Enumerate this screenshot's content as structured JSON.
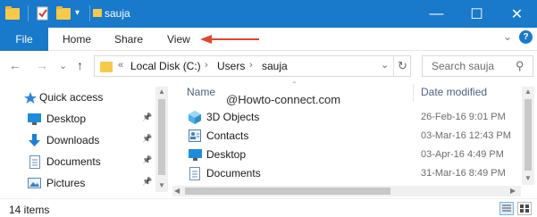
{
  "window": {
    "title": "sauja",
    "minimize_glyph": "—",
    "maximize_glyph": "☐",
    "close_glyph": "✕"
  },
  "ribbon": {
    "file_label": "File",
    "tabs": [
      "Home",
      "Share",
      "View"
    ],
    "collapse_glyph": "⌄",
    "help_glyph": "?"
  },
  "address": {
    "back_glyph": "←",
    "forward_glyph": "→",
    "recent_glyph": "⌄",
    "up_glyph": "↑",
    "overflow": "«",
    "segments": [
      "Local Disk (C:)",
      "Users",
      "sauja"
    ],
    "separator": "›",
    "dropdown_glyph": "⌄",
    "refresh_glyph": "↻"
  },
  "search": {
    "placeholder": "Search sauja",
    "icon_glyph": "⚲"
  },
  "nav": {
    "items": [
      {
        "label": "Quick access",
        "icon": "star-icon"
      },
      {
        "label": "Desktop",
        "icon": "desktop-icon",
        "pinned": true
      },
      {
        "label": "Downloads",
        "icon": "download-icon",
        "pinned": true
      },
      {
        "label": "Documents",
        "icon": "documents-icon",
        "pinned": true
      },
      {
        "label": "Pictures",
        "icon": "pictures-icon",
        "pinned": true
      }
    ],
    "pin_glyph": "📌"
  },
  "content": {
    "columns": {
      "name": "Name",
      "date_modified": "Date modified"
    },
    "watermark": "@Howto-connect.com",
    "rows": [
      {
        "name": "3D Objects",
        "date": "26-Feb-16 9:01 PM",
        "icon": "3d-objects-icon"
      },
      {
        "name": "Contacts",
        "date": "03-Mar-16 12:43 PM",
        "icon": "contacts-icon"
      },
      {
        "name": "Desktop",
        "date": "03-Apr-16 4:49 PM",
        "icon": "desktop-icon"
      },
      {
        "name": "Documents",
        "date": "31-Mar-16 8:49 PM",
        "icon": "documents-icon"
      }
    ]
  },
  "status": {
    "item_count": "14 items"
  },
  "colors": {
    "accent": "#1979ca",
    "annotation_arrow": "#e0452f",
    "folder": "#f6c94b"
  }
}
